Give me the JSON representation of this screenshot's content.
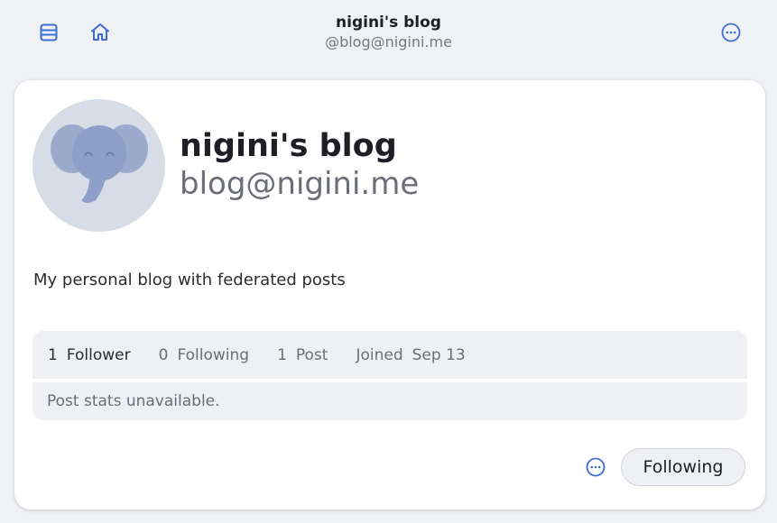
{
  "header": {
    "title": "nigini's blog",
    "subtitle": "@blog@nigini.me",
    "icons": {
      "left_1": "list-icon",
      "left_2": "home-icon",
      "right": "more-icon"
    }
  },
  "profile": {
    "display_name": "nigini's blog",
    "handle": "blog@nigini.me",
    "bio": "My personal blog with federated posts",
    "avatar": "elephant-avatar"
  },
  "stats": {
    "followers": {
      "count": "1",
      "label": "Follower"
    },
    "following": {
      "count": "0",
      "label": "Following"
    },
    "posts": {
      "count": "1",
      "label": "Post"
    },
    "joined": {
      "label": "Joined",
      "date": "Sep 13"
    }
  },
  "post_stats_text": "Post stats unavailable.",
  "actions": {
    "follow_label": "Following"
  },
  "colors": {
    "accent": "#3b6fd6",
    "background": "#f0f1f5",
    "card": "#ffffff",
    "muted_panel": "#eff0f4"
  }
}
